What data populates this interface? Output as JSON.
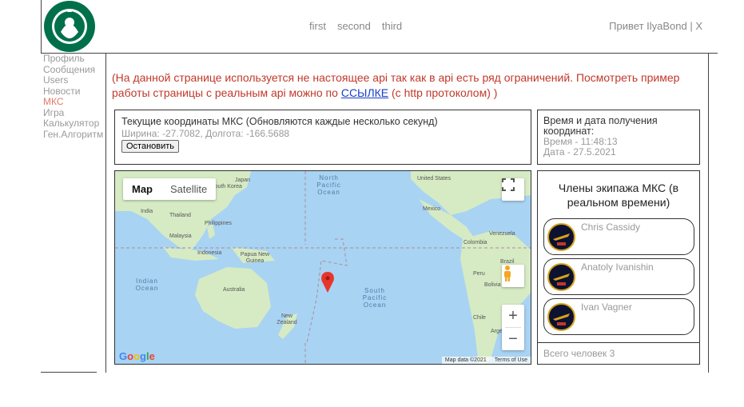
{
  "nav": {
    "links": [
      "first",
      "second",
      "third"
    ],
    "greeting": "Привет IlyaBond | X"
  },
  "sidebar": {
    "items": [
      "Профиль",
      "Сообщения",
      "Users",
      "Новости",
      "МКС",
      "Игра",
      "Калькулятор",
      "Ген.Алгоритм"
    ],
    "active": "МКС"
  },
  "notice": {
    "before": "(На данной странице используется не настоящее api так как в api есть ряд ограничений. Посмотреть пример работы страницы с реальным api можно по ",
    "link": "ССЫЛКЕ",
    "after": " (с http протоколом) )"
  },
  "coords": {
    "title": "Текущие координаты МКС (Обновляются каждые несколько секунд)",
    "values": "Ширина: -27.7082, Долгота: -166.5688",
    "stop_button": "Остановить"
  },
  "time": {
    "title": "Время и дата получения координат:",
    "time": "Время - 11:48:13",
    "date": "Дата - 27.5.2021"
  },
  "map": {
    "toggle_map": "Map",
    "toggle_satellite": "Satellite",
    "logo": "Google",
    "attribution": "Map data ©2021",
    "terms": "Terms of Use",
    "labels": {
      "japan": "Japan",
      "south_korea": "South Korea",
      "india": "India",
      "thailand": "Thailand",
      "philippines": "Philippines",
      "malaysia": "Malaysia",
      "indonesia": "Indonesia",
      "png": "Papua New Guinea",
      "australia": "Australia",
      "nz": "New Zealand",
      "us": "United States",
      "mexico": "Mexico",
      "venezuela": "Venezuela",
      "colombia": "Colombia",
      "peru": "Peru",
      "brazil": "Brazil",
      "bolivia": "Bolivia",
      "chile": "Chile",
      "argentina": "Argentina",
      "north_pacific": "North Pacific Ocean",
      "indian": "Indian Ocean",
      "south_pacific": "South Pacific Ocean"
    },
    "colors": {
      "water": "#a9d3f2",
      "land": "#d6ebc4",
      "marker": "#e8352a"
    }
  },
  "crew": {
    "title": "Члены экипажа МКС (в реальном времени)",
    "members": [
      {
        "name": "Chris Cassidy"
      },
      {
        "name": "Anatoly Ivanishin"
      },
      {
        "name": "Ivan Vagner"
      }
    ],
    "total": "Всего человек 3"
  }
}
